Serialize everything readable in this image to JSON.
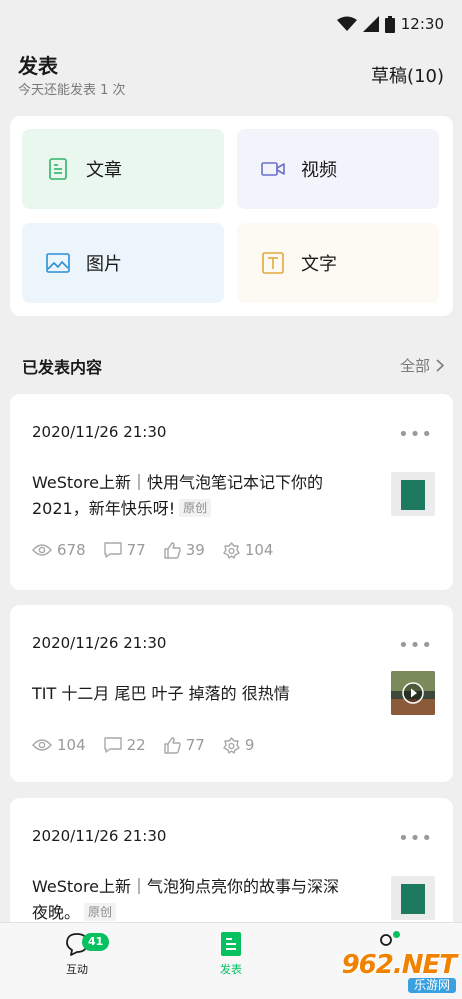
{
  "status_bar": {
    "time": "12:30"
  },
  "header": {
    "title": "发表",
    "subtitle": "今天还能发表 1 次",
    "drafts": "草稿(10)"
  },
  "publish_options": {
    "article": "文章",
    "video": "视频",
    "image": "图片",
    "text": "文字"
  },
  "published_section": {
    "title": "已发表内容",
    "view_all": "全部"
  },
  "posts": [
    {
      "date": "2020/11/26 21:30",
      "title": "WeStore上新｜快用气泡笔记本记下你的2021，新年快乐呀!",
      "tag": "原创",
      "views": "678",
      "comments": "77",
      "likes": "39",
      "shares": "104"
    },
    {
      "date": "2020/11/26 21:30",
      "title": "TIT 十二月 尾巴 叶子 掉落的 很热情",
      "views": "104",
      "comments": "22",
      "likes": "77",
      "shares": "9"
    },
    {
      "date": "2020/11/26 21:30",
      "title": "WeStore上新｜气泡狗点亮你的故事与深深夜晚。",
      "tag": "原创"
    }
  ],
  "tabbar": {
    "interact": "互动",
    "interact_badge": "41",
    "publish": "发表"
  },
  "watermark": {
    "line1": "962.NET",
    "line2": "乐游网"
  },
  "colors": {
    "accent": "#07c160",
    "background": "#efefef",
    "card": "#ffffff"
  }
}
